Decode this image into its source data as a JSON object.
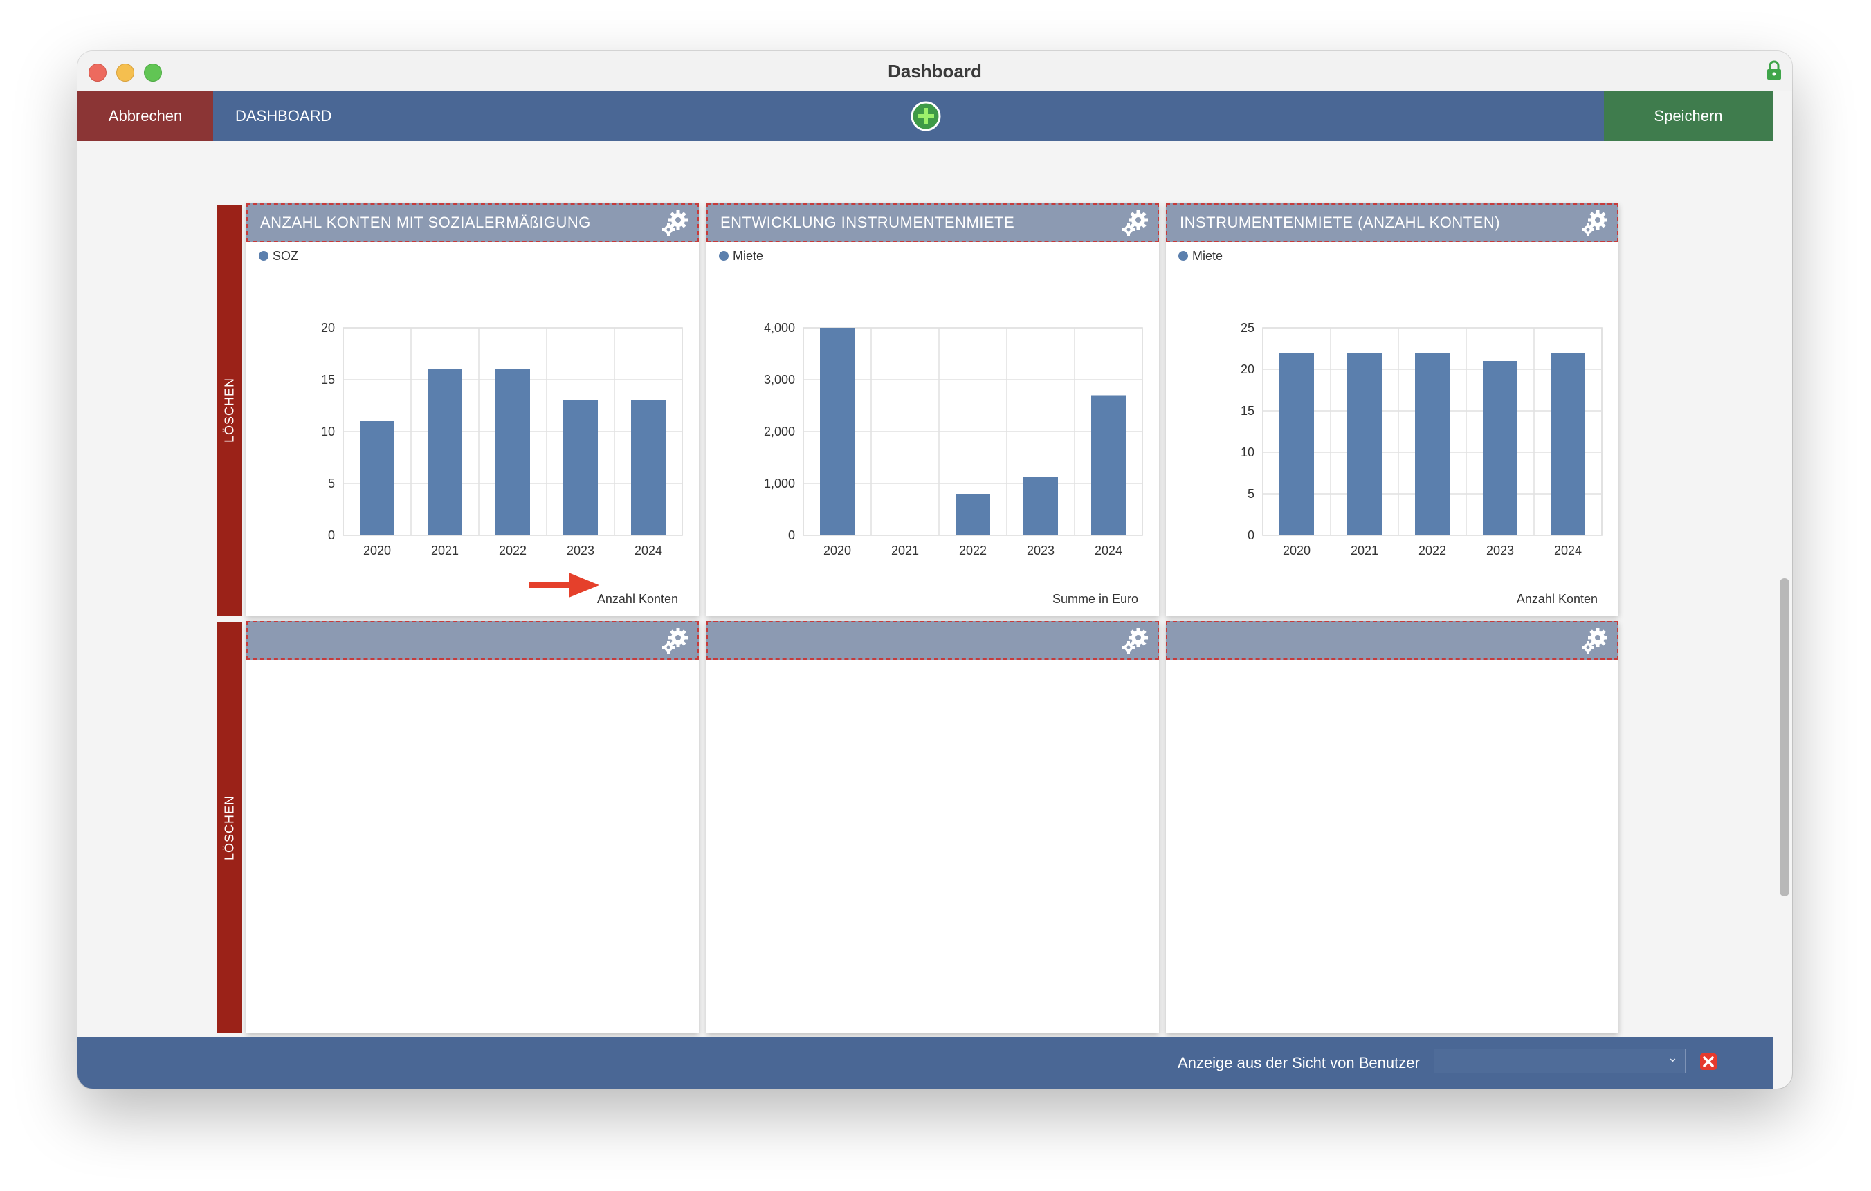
{
  "window": {
    "title": "Dashboard"
  },
  "toolbar": {
    "cancel_label": "Abbrechen",
    "breadcrumb": "DASHBOARD",
    "save_label": "Speichern"
  },
  "rows": [
    {
      "delete_label": "LÖSCHEN"
    },
    {
      "delete_label": "LÖSCHEN"
    }
  ],
  "widgets": [
    {
      "title": "ANZAHL KONTEN MIT SOZIALERMÄßIGUNG",
      "legend": "SOZ",
      "footnote": "Anzahl Konten"
    },
    {
      "title": "ENTWICKLUNG INSTRUMENTENMIETE",
      "legend": "Miete",
      "footnote": "Summe in Euro"
    },
    {
      "title": "INSTRUMENTENMIETE (ANZAHL KONTEN)",
      "legend": "Miete",
      "footnote": "Anzahl Konten"
    }
  ],
  "chart_data": [
    {
      "type": "bar",
      "categories": [
        "2020",
        "2021",
        "2022",
        "2023",
        "2024"
      ],
      "series": [
        {
          "name": "SOZ",
          "values": [
            11,
            16,
            16,
            13,
            13
          ]
        }
      ],
      "yticks": [
        "0",
        "5",
        "10",
        "15",
        "20"
      ],
      "ylim": [
        0,
        20
      ],
      "xlabel": "Anzahl Konten",
      "grid": true,
      "legend_position": "top-left",
      "color": "#5b7fad"
    },
    {
      "type": "bar",
      "categories": [
        "2020",
        "2021",
        "2022",
        "2023",
        "2024"
      ],
      "series": [
        {
          "name": "Miete",
          "values": [
            4000,
            0,
            800,
            1120,
            2700
          ]
        }
      ],
      "yticks": [
        "0",
        "1,000",
        "2,000",
        "3,000",
        "4,000"
      ],
      "ylim": [
        0,
        4000
      ],
      "xlabel": "Summe in Euro",
      "grid": true,
      "legend_position": "top-left",
      "color": "#5b7fad"
    },
    {
      "type": "bar",
      "categories": [
        "2020",
        "2021",
        "2022",
        "2023",
        "2024"
      ],
      "series": [
        {
          "name": "Miete",
          "values": [
            22,
            22,
            22,
            21,
            22
          ]
        }
      ],
      "yticks": [
        "0",
        "5",
        "10",
        "15",
        "20",
        "25"
      ],
      "ylim": [
        0,
        25
      ],
      "xlabel": "Anzahl Konten",
      "grid": true,
      "legend_position": "top-left",
      "color": "#5b7fad"
    }
  ],
  "statusbar": {
    "label": "Anzeige aus der Sicht von Benutzer",
    "user_value": ""
  },
  "colors": {
    "header_blue": "#4a6795",
    "cancel_red": "#8b3535",
    "save_green": "#3f7c4d",
    "delete_red": "#9b2218",
    "panel_header": "#8c9ab2",
    "bar": "#5b7fad",
    "arrow_red": "#e5402b"
  }
}
